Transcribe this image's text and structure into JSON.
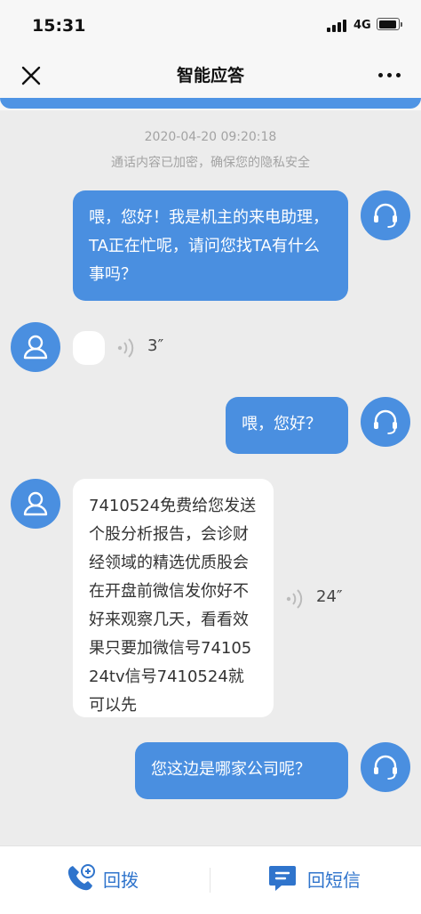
{
  "status_bar": {
    "time": "15:31",
    "network": "4G"
  },
  "nav": {
    "title": "智能应答",
    "close_icon": "close-icon",
    "more_icon": "more-dots-icon"
  },
  "chat": {
    "timestamp": "2020-04-20 09:20:18",
    "privacy_note": "通话内容已加密，确保您的隐私安全",
    "messages": [
      {
        "from": "assistant",
        "text": "喂，您好！我是机主的来电助理，TA正在忙呢，请问您找TA有什么事吗？"
      },
      {
        "from": "caller",
        "text": "",
        "duration": "3″"
      },
      {
        "from": "assistant",
        "text": "喂，您好？"
      },
      {
        "from": "caller",
        "text": "7410524免费给您发送个股分析报告，会诊财经领域的精选优质股会在开盘前微信发你好不好来观察几天，看看效果只要加微信号7410524tv信号7410524就可以先",
        "duration": "24″"
      },
      {
        "from": "assistant",
        "text": "您这边是哪家公司呢？"
      }
    ]
  },
  "bottom_bar": {
    "callback_label": "回拨",
    "sms_label": "回短信",
    "accent_color": "#2f74cc"
  },
  "colors": {
    "bubble_out": "#4a8fe0",
    "background": "#ececec"
  }
}
